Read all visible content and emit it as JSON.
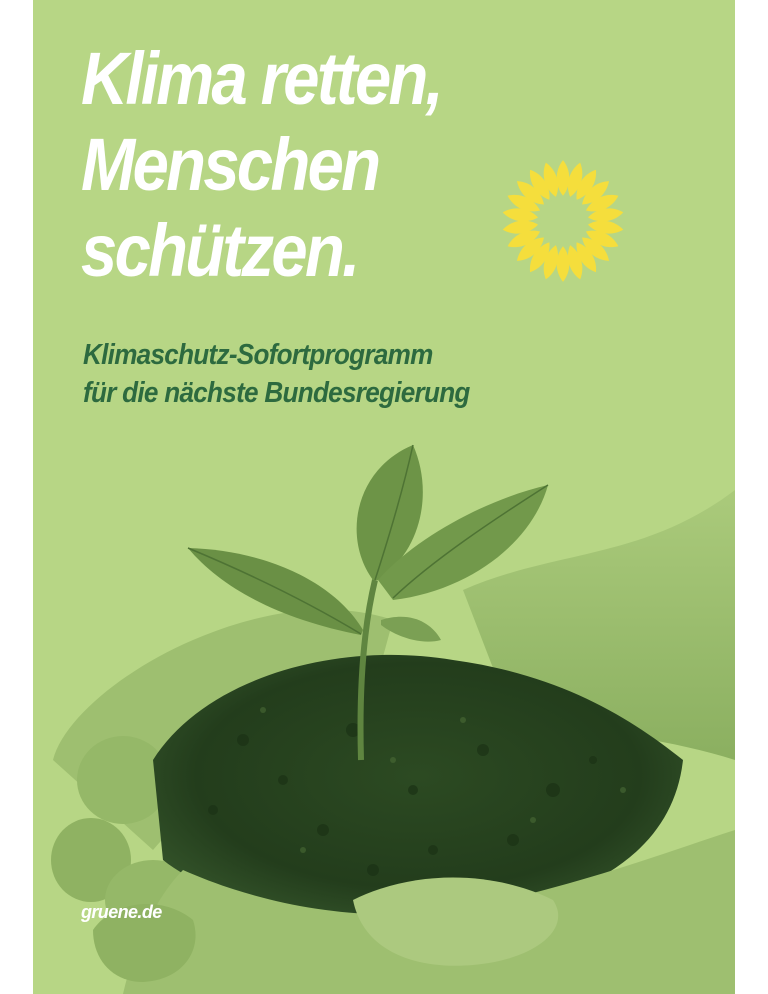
{
  "poster": {
    "headline": [
      "Klima retten,",
      "Menschen",
      "schützen."
    ],
    "subline": [
      "Klimaschutz-Sofortprogramm",
      "für die nächste Bundesregierung"
    ],
    "url": "gruene.de",
    "logo_icon": "sunflower-icon",
    "photo_subject": "hands-holding-seedling-in-soil",
    "colors": {
      "background": "#b7d685",
      "headline": "#ffffff",
      "subline": "#2d6a3f",
      "sunflower": "#f5de3c"
    }
  }
}
